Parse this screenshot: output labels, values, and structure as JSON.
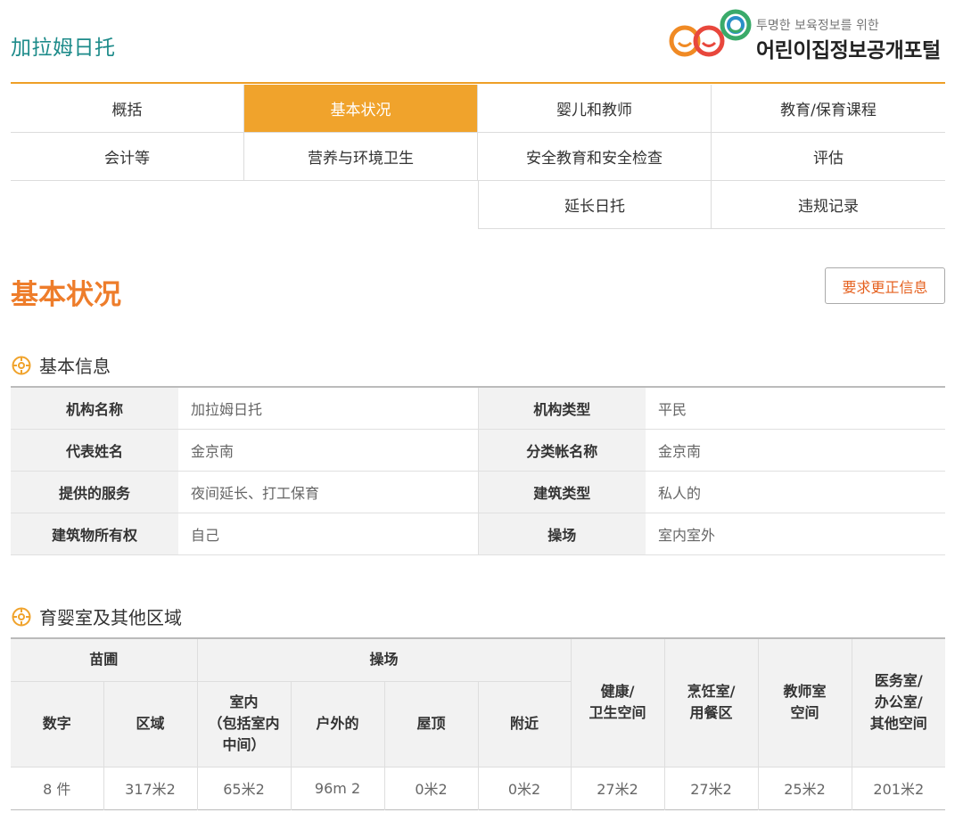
{
  "header": {
    "site_name": "加拉姆日托",
    "logo_tagline": "투명한 보육정보를 위한",
    "logo_title": "어린이집정보공개포털"
  },
  "tabs": [
    {
      "label": "概括"
    },
    {
      "label": "基本状况",
      "active": true
    },
    {
      "label": "婴儿和教师"
    },
    {
      "label": "教育/保育课程"
    },
    {
      "label": "会计等"
    },
    {
      "label": "营养与环境卫生"
    },
    {
      "label": "安全教育和安全检查"
    },
    {
      "label": "评估"
    },
    {
      "label": "延长日托"
    },
    {
      "label": "违规记录"
    }
  ],
  "page": {
    "title": "基本状况",
    "correct_button": "要求更正信息"
  },
  "basic_info": {
    "heading": "基本信息",
    "rows": [
      {
        "k1": "机构名称",
        "v1": "加拉姆日托",
        "k2": "机构类型",
        "v2": "平民"
      },
      {
        "k1": "代表姓名",
        "v1": "金京南",
        "k2": "分类帐名称",
        "v2": "金京南"
      },
      {
        "k1": "提供的服务",
        "v1": "夜间延长、打工保育",
        "k2": "建筑类型",
        "v2": "私人的"
      },
      {
        "k1": "建筑物所有权",
        "v1": "自己",
        "k2": "操场",
        "v2": "室内室外"
      }
    ]
  },
  "area": {
    "heading": "育婴室及其他区域",
    "group_nursery": "苗圃",
    "group_playground": "操场",
    "col_health": "健康/\n卫生空间",
    "col_kitchen": "烹饪室/\n用餐区",
    "col_teacher": "教师室\n空间",
    "col_medical": "医务室/\n办公室/\n其他空间",
    "col_count": "数字",
    "col_area": "区域",
    "col_indoor": "室内\n（包括室内\n中间）",
    "col_outdoor": "户外的",
    "col_roof": "屋顶",
    "col_nearby": "附近",
    "values": [
      "8 件",
      "317米2",
      "65米2",
      "96m 2",
      "0米2",
      "0米2",
      "27米2",
      "27米2",
      "25米2",
      "201米2"
    ]
  },
  "colors": {
    "accent_orange": "#f0a32c",
    "title_orange": "#ee7d2b",
    "teal": "#1d8b8a"
  }
}
